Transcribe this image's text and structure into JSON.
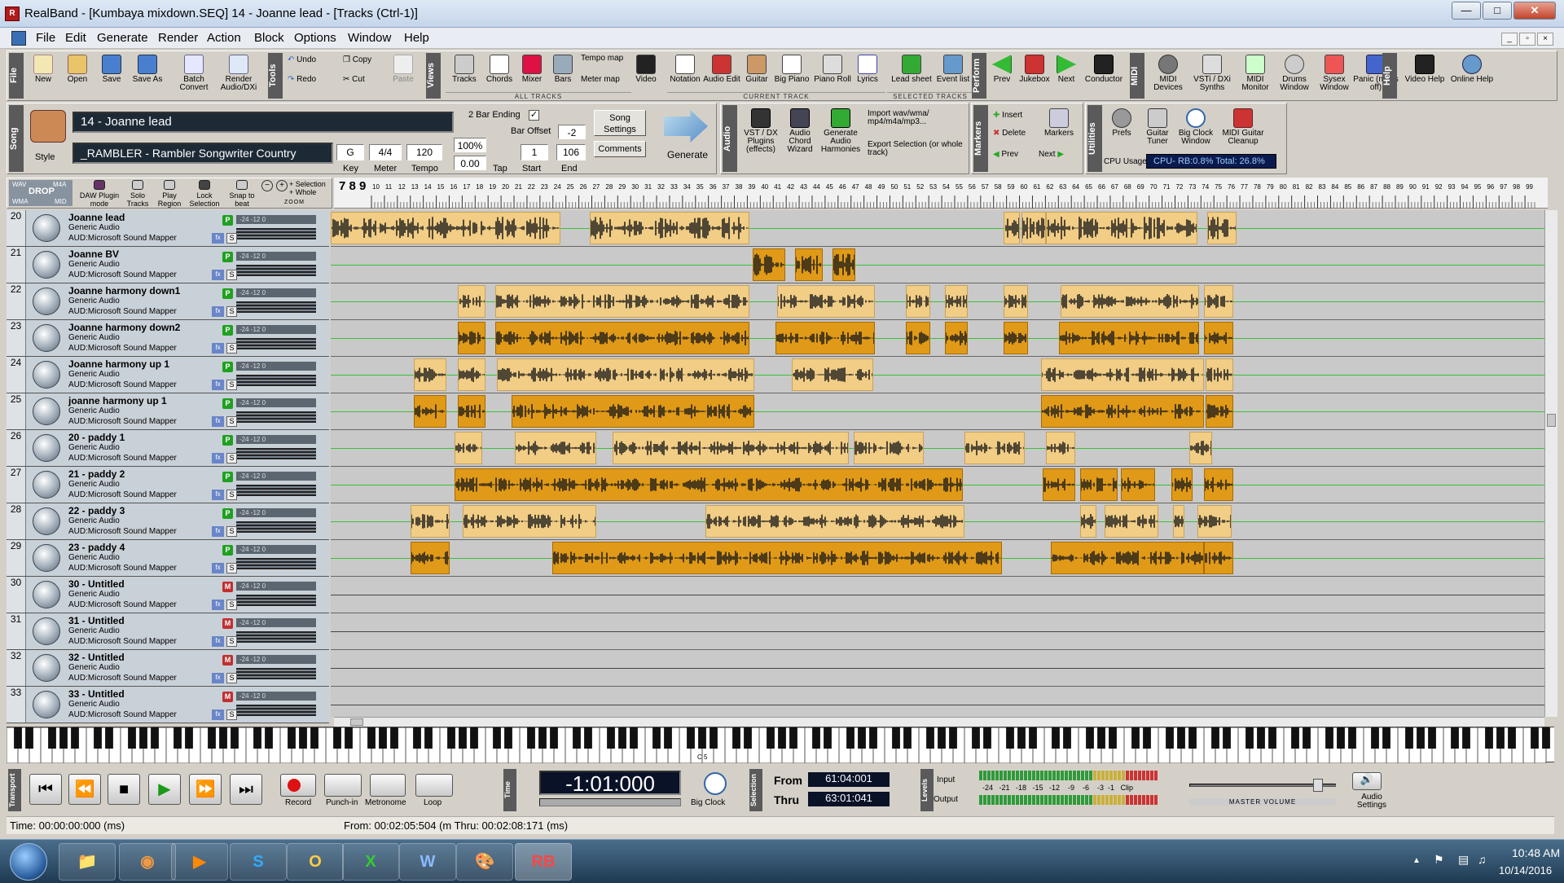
{
  "window": {
    "title": "RealBand - [Kumbaya mixdown.SEQ]     14 - Joanne lead - [Tracks (Ctrl-1)]",
    "minimize": "—",
    "maximize": "□",
    "close": "✕"
  },
  "menu": [
    "File",
    "Edit",
    "Generate",
    "Render",
    "Action",
    "Block",
    "Options",
    "Window",
    "Help"
  ],
  "toolbar": {
    "file_label": "File",
    "tools_label": "Tools",
    "views_label": "Views",
    "perform_label": "Perform",
    "midi_label": "MIDI",
    "help_label": "Help",
    "file_buttons": [
      "New",
      "Open",
      "Save",
      "Save As",
      "Batch Convert",
      "Render Audio/DXi"
    ],
    "tools_buttons": [
      "Undo",
      "Redo",
      "Copy",
      "Cut",
      "Paste"
    ],
    "views_buttons": [
      "Tracks",
      "Chords",
      "Mixer",
      "Bars",
      "Tempo map",
      "Meter map",
      "Video",
      "Notation",
      "Audio Edit",
      "Guitar",
      "Big Piano",
      "Piano Roll",
      "Lyrics",
      "Lead sheet",
      "Event list"
    ],
    "views_captions": [
      "ALL TRACKS",
      "CURRENT TRACK",
      "SELECTED TRACKS"
    ],
    "perform_buttons": [
      "Prev",
      "Jukebox",
      "Next",
      "Conductor"
    ],
    "midi_buttons": [
      "MIDI Devices",
      "VSTi / DXi Synths",
      "MIDI Monitor",
      "Drums Window",
      "Sysex Window",
      "Panic (notes off)"
    ],
    "help_buttons": [
      "Video Help",
      "Online Help"
    ]
  },
  "song": {
    "label": "Song",
    "style_label": "Style",
    "title": "14 - Joanne lead",
    "style": "_RAMBLER - Rambler Songwriter Country",
    "two_bar_ending": "2 Bar Ending",
    "bar_offset_label": "Bar Offset",
    "bar_offset": "-2",
    "key": "G",
    "meter": "4/4",
    "tempo": "120",
    "tempo_pct": "100%",
    "tempo_fine": "0.00",
    "start": "1",
    "end": "106",
    "key_label": "Key",
    "meter_label": "Meter",
    "tempo_label": "Tempo",
    "tap_label": "Tap",
    "start_label": "Start",
    "end_label": "End",
    "song_settings": "Song Settings",
    "comments": "Comments",
    "generate": "Generate"
  },
  "audio_panel": {
    "label": "Audio",
    "buttons": [
      "VST / DX Plugins (effects)",
      "Audio Chord Wizard",
      "Generate Audio Harmonies"
    ],
    "import": "Import wav/wma/ mp4/m4a/mp3...",
    "export": "Export Selection (or whole track)"
  },
  "markers_panel": {
    "label": "Markers",
    "insert": "Insert",
    "delete": "Delete",
    "markers": "Markers",
    "prev": "Prev",
    "next": "Next"
  },
  "utilities_panel": {
    "label": "Utilities",
    "buttons": [
      "Prefs",
      "Guitar Tuner",
      "Big Clock Window",
      "MIDI Guitar Cleanup"
    ],
    "cpu_label": "CPU Usage",
    "cpu_value": "CPU- RB:0.8% Total: 26.8%"
  },
  "track_tools": {
    "drop": "DROP",
    "wav": "WAV",
    "wma": "WMA",
    "m4a": "M4A",
    "mid": "MID",
    "buttons": [
      "DAW Plugin mode",
      "Solo Tracks",
      "Play Region",
      "Lock Selection",
      "Snap to beat"
    ],
    "selection": "+ Selection + Whole",
    "zoom": "ZOOM"
  },
  "ruler": {
    "start_digits": "7 8 9",
    "first_bar": 10,
    "last_bar": 99
  },
  "tracks": [
    {
      "num": "20",
      "name": "Joanne lead",
      "badge": "P",
      "color": "#20a020"
    },
    {
      "num": "21",
      "name": "Joanne BV",
      "badge": "P",
      "color": "#20a020"
    },
    {
      "num": "22",
      "name": "Joanne harmony down1",
      "badge": "P",
      "color": "#20a020"
    },
    {
      "num": "23",
      "name": "Joanne harmony down2",
      "badge": "P",
      "color": "#20a020"
    },
    {
      "num": "24",
      "name": "Joanne harmony up 1",
      "badge": "P",
      "color": "#20a020"
    },
    {
      "num": "25",
      "name": "joanne harmony up 1",
      "badge": "P",
      "color": "#20a020"
    },
    {
      "num": "26",
      "name": "20 - paddy 1",
      "badge": "P",
      "color": "#20a020"
    },
    {
      "num": "27",
      "name": "21 - paddy 2",
      "badge": "P",
      "color": "#20a020"
    },
    {
      "num": "28",
      "name": "22 - paddy 3",
      "badge": "P",
      "color": "#20a020"
    },
    {
      "num": "29",
      "name": "23 - paddy 4",
      "badge": "P",
      "color": "#20a020"
    },
    {
      "num": "30",
      "name": "30 - Untitled",
      "badge": "M",
      "color": "#c03030"
    },
    {
      "num": "31",
      "name": "31 - Untitled",
      "badge": "M",
      "color": "#c03030"
    },
    {
      "num": "32",
      "name": "32 - Untitled",
      "badge": "M",
      "color": "#c03030"
    },
    {
      "num": "33",
      "name": "33 - Untitled",
      "badge": "M",
      "color": "#c03030"
    }
  ],
  "track_common": {
    "type": "Generic Audio",
    "device": "AUD:Microsoft Sound Mapper",
    "meter_text": "-24  -12    0",
    "fx": "fx",
    "s": "S"
  },
  "piano": {
    "c5_label": "C 5"
  },
  "transport": {
    "label": "Transport",
    "buttons": [
      "⏮",
      "⏪",
      "■",
      "▶",
      "⏩",
      "⏭"
    ],
    "record": "Record",
    "punch": "Punch-in",
    "metronome": "Metronome",
    "loop": "Loop",
    "time_label": "Time",
    "time": "-1:01:000",
    "big_clock": "Big Clock",
    "selection_label": "Selection",
    "from_label": "From",
    "thru_label": "Thru",
    "from": "61:04:001",
    "thru": "63:01:041",
    "levels_label": "Levels",
    "input_label": "Input",
    "output_label": "Output",
    "scale": "-24   -21   -18   -15   -12    -9    -6    -3  -1   Clip",
    "master_volume": "MASTER VOLUME",
    "audio_settings": "Audio Settings"
  },
  "status": {
    "left": "Time: 00:00:00:000 (ms)",
    "right": "From: 00:02:05:504 (m  Thru: 00:02:08:171 (ms)"
  },
  "taskbar": {
    "apps": [
      "Explorer",
      "Chrome",
      "Media",
      "Skype",
      "Outlook",
      "Excel",
      "Word",
      "Paint",
      "RealBand"
    ],
    "time": "10:48 AM",
    "date": "10/14/2016"
  },
  "colors": {
    "clip_light": "#f1cd85",
    "clip_dark": "#e09a17",
    "wave": "#1a1a1a",
    "header_bg": "#c9d1d8"
  }
}
